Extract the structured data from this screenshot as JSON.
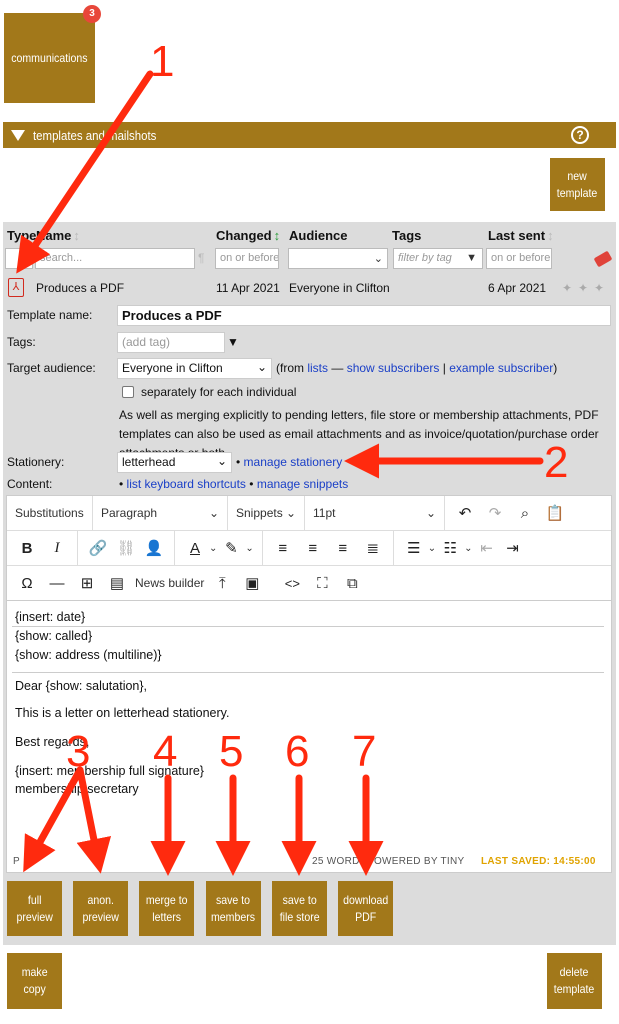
{
  "top": {
    "communications_label": "communications",
    "badge_count": "3"
  },
  "section": {
    "title": "templates and mailshots",
    "help": "?"
  },
  "new_template_label": "new\ntemplate",
  "table": {
    "headers": {
      "type": "Type",
      "name": "Name",
      "changed": "Changed",
      "audience": "Audience",
      "tags": "Tags",
      "last_sent": "Last sent"
    },
    "filters": {
      "name_placeholder": "search...",
      "changed_placeholder": "on or before...",
      "tags_placeholder": "filter by tag",
      "last_sent_placeholder": "on or before..."
    },
    "row": {
      "name": "Produces a PDF",
      "changed": "11 Apr 2021",
      "audience": "Everyone in Clifton",
      "last_sent": "6 Apr 2021"
    }
  },
  "form": {
    "template_name_label": "Template name:",
    "template_name_value": "Produces a PDF",
    "tags_label": "Tags:",
    "tags_placeholder": "(add tag)",
    "target_label": "Target audience:",
    "target_value": "Everyone in Clifton",
    "from_text": "(from",
    "lists_link": "lists",
    "dash": "—",
    "show_subscribers_link": "show subscribers",
    "pipe": "|",
    "example_subscriber_link": "example subscriber",
    "close_paren": ")",
    "separately_label": "separately for each individual",
    "info_text": "As well as merging explicitly to pending letters, file store or membership attachments, PDF templates can also be used as email attachments and as invoice/quotation/purchase order attachments or both",
    "stationery_label": "Stationery:",
    "stationery_value": "letterhead",
    "manage_stationery_link": "manage stationery",
    "content_label": "Content:",
    "keyboard_shortcuts_link": "list keyboard shortcuts",
    "manage_snippets_link": "manage snippets",
    "bullet": "•"
  },
  "editor": {
    "toolbar1": {
      "substitutions": "Substitutions",
      "paragraph": "Paragraph",
      "snippets": "Snippets",
      "font_size": "11pt"
    },
    "news_builder": "News builder",
    "lines": [
      "{insert: date}",
      "{show: called}",
      "{show: address (multiline)}",
      "Dear {show: salutation},",
      "This is a letter on letterhead stationery.",
      "Best regards,",
      "{insert: membership full signature}",
      "membership secretary"
    ],
    "status": {
      "path": "P",
      "words": "25 WORDS",
      "powered": "POWERED BY TINY",
      "saved": "LAST SAVED: 14:55:00"
    }
  },
  "buttons": {
    "full_preview": "full\npreview",
    "anon_preview": "anon.\npreview",
    "merge_to_letters": "merge to\nletters",
    "save_to_members": "save to\nmembers",
    "save_to_file_store": "save to\nfile store",
    "download_pdf": "download\nPDF",
    "make_copy": "make\ncopy",
    "delete_template": "delete\ntemplate"
  },
  "annotations": [
    "1",
    "2",
    "3",
    "4",
    "5",
    "6",
    "7"
  ],
  "colors": {
    "accent": "#a2781a",
    "annotation": "#ff2a0e",
    "badge": "#e8473a",
    "link": "#1a3fc7",
    "saved": "#e0a300"
  }
}
